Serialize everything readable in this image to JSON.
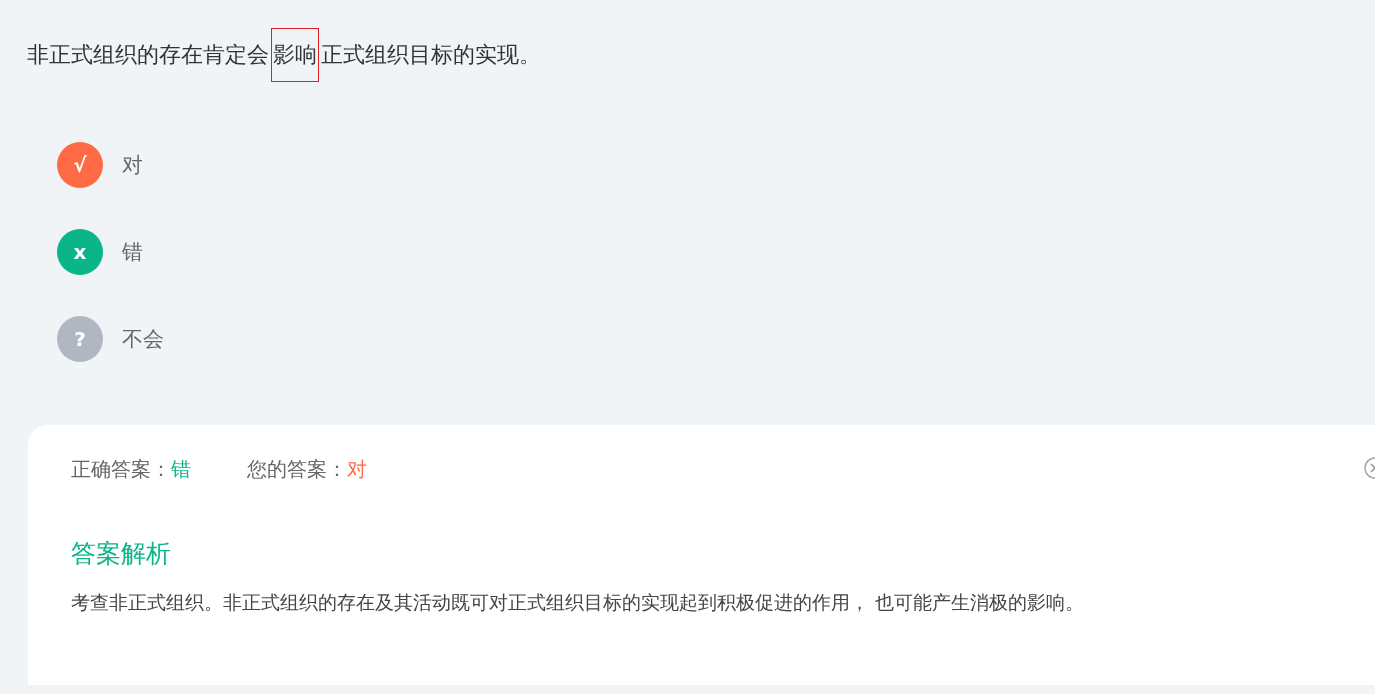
{
  "question": {
    "before": "非正式组织的存在肯定会",
    "highlight": "影响",
    "after": "正式组织目标的实现。"
  },
  "options": [
    {
      "mark": "√",
      "label": "对",
      "color": "#ff6a45"
    },
    {
      "mark": "x",
      "label": "错",
      "color": "#0bb58a"
    },
    {
      "mark": "?",
      "label": "不会",
      "color": "#b0b7c3"
    }
  ],
  "result": {
    "correct_label": "正确答案：",
    "correct_value": "错",
    "yours_label": "您的答案：",
    "yours_value": "对"
  },
  "analysis": {
    "title": "答案解析",
    "text": "考查非正式组织。非正式组织的存在及其活动既可对正式组织目标的实现起到积极促进的作用， 也可能产生消极的影响。"
  }
}
